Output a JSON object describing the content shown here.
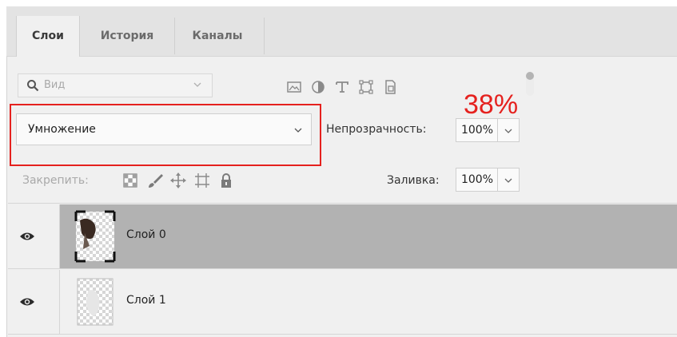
{
  "tabs": [
    {
      "label": "Слои",
      "active": true
    },
    {
      "label": "История",
      "active": false
    },
    {
      "label": "Каналы",
      "active": false
    }
  ],
  "search": {
    "icon": "search-icon",
    "placeholder": "Вид"
  },
  "filter_icons": [
    "image-filter-icon",
    "adjustment-filter-icon",
    "type-filter-icon",
    "shape-filter-icon",
    "smart-object-filter-icon"
  ],
  "blend_mode": {
    "value": "Умножение"
  },
  "opacity": {
    "label": "Непрозрачность:",
    "value": "100%"
  },
  "annotation": {
    "text": "38%",
    "color": "#e5211e"
  },
  "lock": {
    "label": "Закрепить:",
    "icons": [
      "lock-transparent-icon",
      "lock-brush-icon",
      "lock-move-icon",
      "lock-artboard-icon",
      "lock-all-icon"
    ]
  },
  "fill": {
    "label": "Заливка:",
    "value": "100%"
  },
  "layers": [
    {
      "name": "Слой 0",
      "selected": true,
      "visible": true
    },
    {
      "name": "Слой 1",
      "selected": false,
      "visible": true
    }
  ],
  "colors": {
    "panel": "#f0f0f0",
    "selected_layer": "#b2b2b2",
    "highlight": "#e5211e"
  }
}
